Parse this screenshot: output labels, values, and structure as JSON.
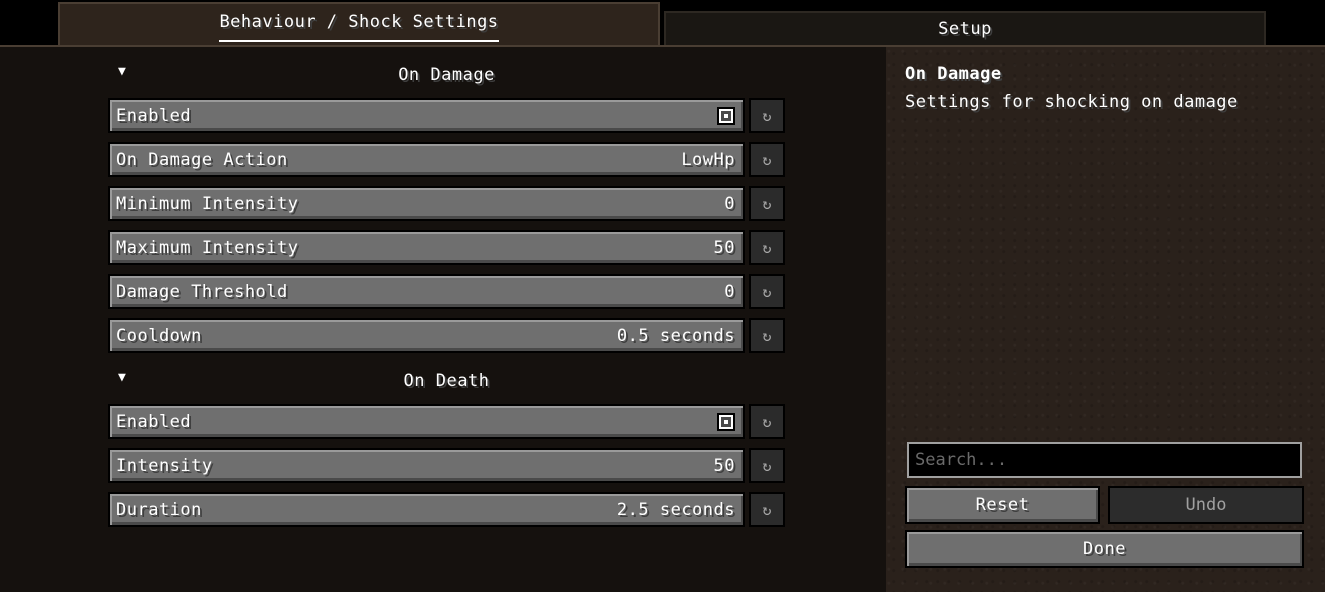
{
  "tabs": [
    {
      "label": "Behaviour / Shock Settings",
      "active": true
    },
    {
      "label": "Setup",
      "active": false
    }
  ],
  "sections": [
    {
      "title": "On Damage",
      "expanded_icon": "triangle-down-icon",
      "options": [
        {
          "label": "Enabled",
          "type": "checkbox",
          "checked": true
        },
        {
          "label": "On Damage Action",
          "value": "LowHp"
        },
        {
          "label": "Minimum Intensity",
          "value": "0"
        },
        {
          "label": "Maximum Intensity",
          "value": "50"
        },
        {
          "label": "Damage Threshold",
          "value": "0"
        },
        {
          "label": "Cooldown",
          "value": "0.5 seconds"
        }
      ]
    },
    {
      "title": "On Death",
      "expanded_icon": "triangle-down-icon",
      "options": [
        {
          "label": "Enabled",
          "type": "checkbox",
          "checked": true
        },
        {
          "label": "Intensity",
          "value": "50"
        },
        {
          "label": "Duration",
          "value": "2.5 seconds"
        }
      ]
    }
  ],
  "reset_icon": "reset-arrow-icon",
  "description": {
    "title": "On Damage",
    "text": "Settings for shocking on damage"
  },
  "search": {
    "placeholder": "Search...",
    "value": ""
  },
  "buttons": {
    "reset": "Reset",
    "undo": "Undo",
    "done": "Done"
  },
  "colors": {
    "button_face": "#6f6f6f",
    "disabled_button": "#2c2c2c",
    "panel_left": "#15110e",
    "panel_right": "#2a211b"
  }
}
